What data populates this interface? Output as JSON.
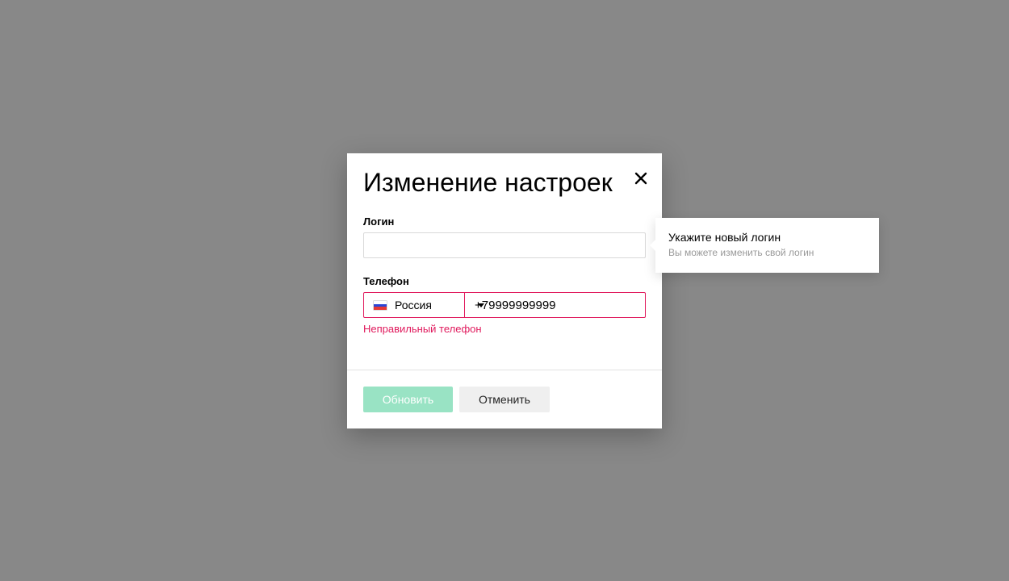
{
  "modal": {
    "title": "Изменение настроек",
    "close_icon": "close-icon",
    "login": {
      "label": "Логин",
      "value": "",
      "placeholder": ""
    },
    "phone": {
      "label": "Телефон",
      "country": "Россия",
      "country_flag": "russia-flag-icon",
      "number": "+79999999999",
      "error": "Неправильный телефон"
    },
    "buttons": {
      "update": "Обновить",
      "cancel": "Отменить"
    }
  },
  "tooltip": {
    "title": "Укажите новый логин",
    "subtitle": "Вы можете изменить свой логин"
  },
  "colors": {
    "backdrop": "#888888",
    "error": "#e0195c",
    "primary_disabled": "#99e3c4",
    "secondary_button": "#efefef"
  }
}
